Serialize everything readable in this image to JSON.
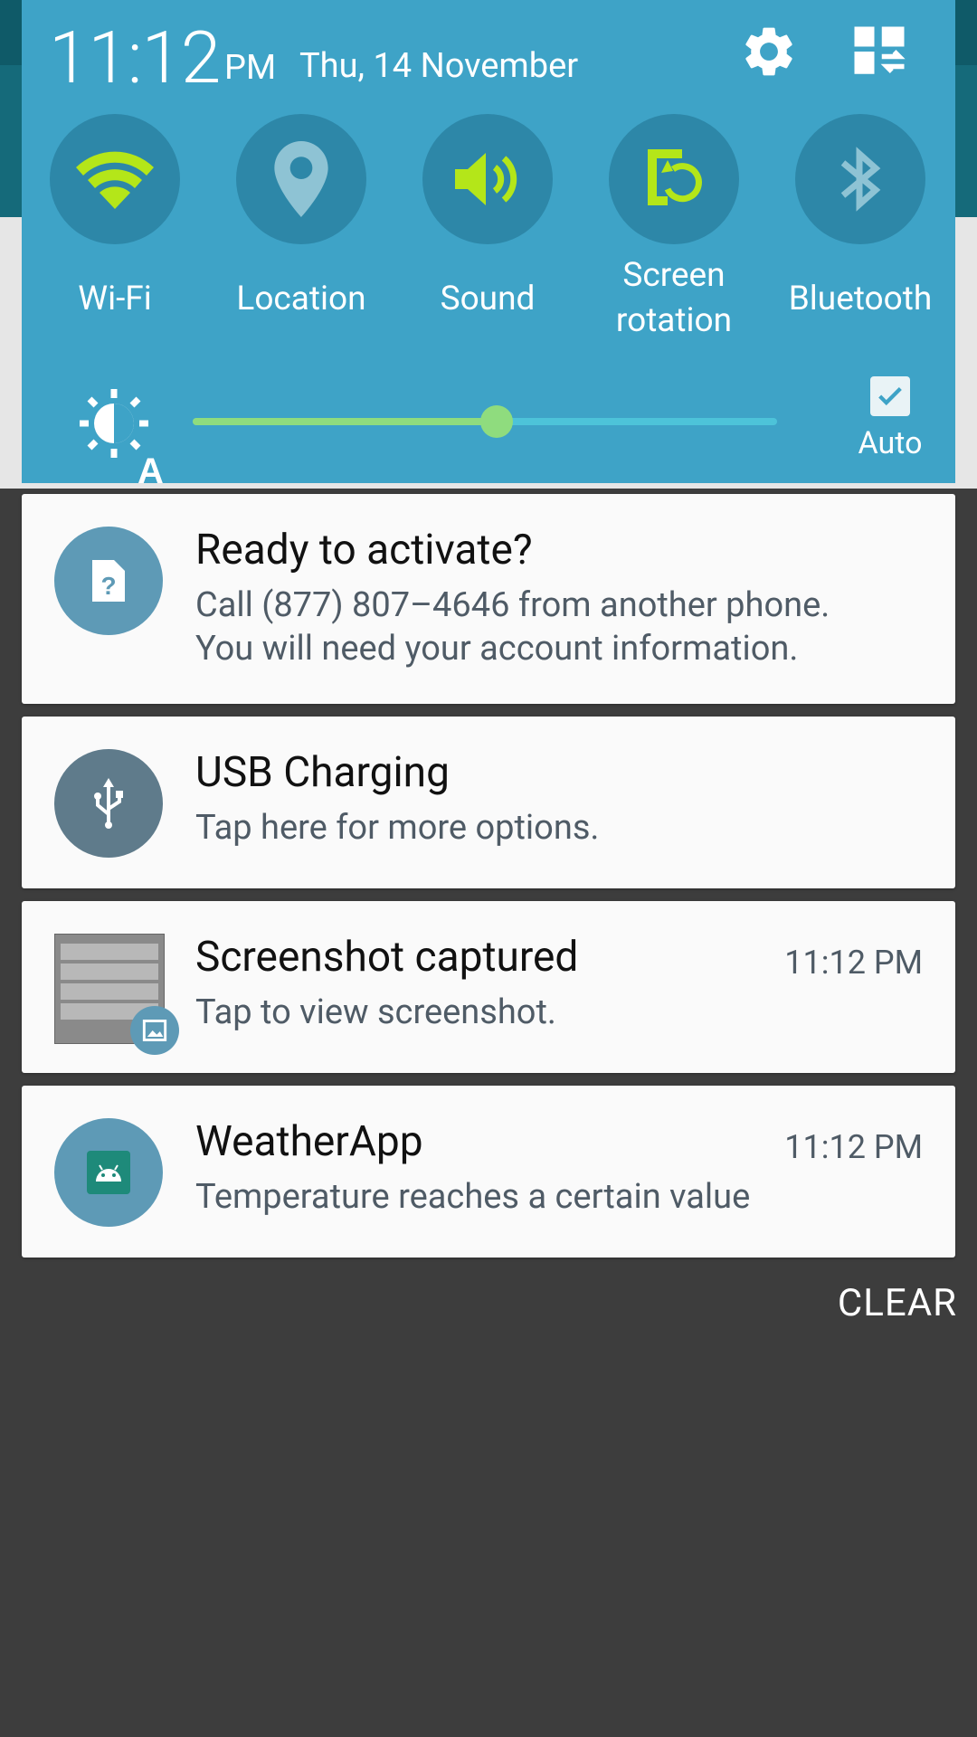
{
  "status": {
    "time": "11:12",
    "ampm": "PM",
    "date": "Thu, 14 November"
  },
  "quick_settings": {
    "toggles": [
      {
        "label": "Wi-Fi",
        "icon": "wifi-icon",
        "active": true
      },
      {
        "label": "Location",
        "icon": "location-pin-icon",
        "active": false
      },
      {
        "label": "Sound",
        "icon": "volume-icon",
        "active": true
      },
      {
        "label_line1": "Screen",
        "label_line2": "rotation",
        "icon": "screen-rotation-icon",
        "active": true
      },
      {
        "label": "Bluetooth",
        "icon": "bluetooth-icon",
        "active": false
      }
    ],
    "brightness_level": 0.52,
    "auto_label": "Auto",
    "auto_checked": true
  },
  "notifications": [
    {
      "title": "Ready to activate?",
      "line1": "Call (877) 807–4646 from another phone.",
      "line2": "You will need your account information.",
      "icon": "sim-question-icon"
    },
    {
      "title": "USB Charging",
      "line1": "Tap here for more options.",
      "icon": "usb-icon"
    },
    {
      "title": "Screenshot captured",
      "line1": "Tap to view screenshot.",
      "time": "11:12 PM",
      "icon": "gallery-icon"
    },
    {
      "title": "WeatherApp",
      "line1": "Temperature reaches a certain value",
      "time": "11:12 PM",
      "icon": "android-icon"
    }
  ],
  "clear_label": "CLEAR",
  "colors": {
    "panel": "#3ea3c7",
    "toggle_bg": "#2d87a8",
    "active": "#b4e619",
    "inactive": "#8ec3d4"
  }
}
